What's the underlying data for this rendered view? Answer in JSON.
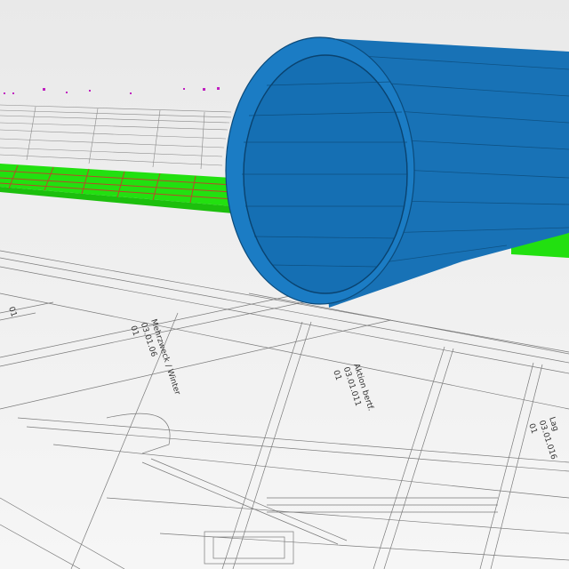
{
  "scene": {
    "background": "#f3f3f3",
    "floor_line_color": "#8a8a8a",
    "beam_color": "#22e010",
    "beam_edge_color": "#b84a2a",
    "tube_color": "#1a78bf",
    "tube_dark": "#0f5e97",
    "tube_edge": "#0a3f66",
    "marker_color": "#c020c0"
  },
  "rooms": [
    {
      "name": "Mehrzweck / Winter",
      "number": "03.01.06",
      "level": "01"
    },
    {
      "name": "Aktion bertf.",
      "number": "03.01.011",
      "level": "01"
    },
    {
      "name": "Lag",
      "number": "03.01.016",
      "level": "01"
    },
    {
      "name": "",
      "number": "",
      "level": "01"
    }
  ]
}
